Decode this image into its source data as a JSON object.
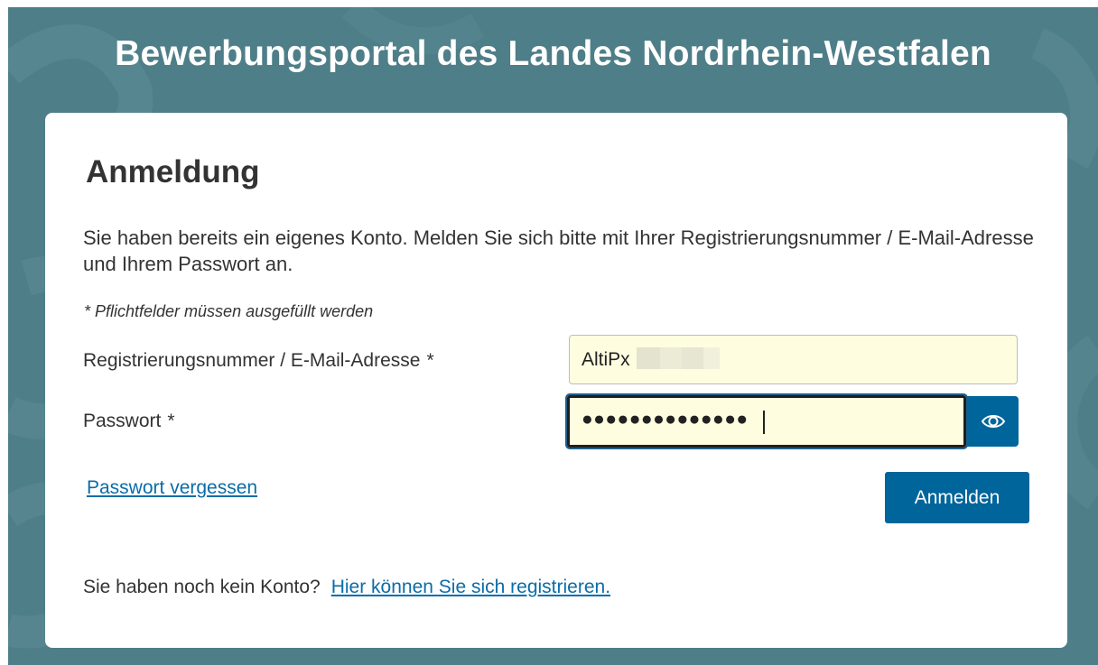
{
  "header": {
    "title": "Bewerbungsportal des Landes Nordrhein-Westfalen"
  },
  "login": {
    "title": "Anmeldung",
    "intro": "Sie haben bereits ein eigenes Konto. Melden Sie sich bitte mit Ihrer Registrierungsnummer / E-Mail-Adresse und Ihrem Passwort an.",
    "required_note": "* Pflichtfelder müssen ausgefüllt werden",
    "username_label": "Registrierungsnummer / E-Mail-Adresse",
    "username_value": "AltiPx",
    "password_label": "Passwort",
    "password_mask": "●●●●●●●●●●●●●●",
    "required_marker": "*",
    "forgot_password": "Passwort vergessen",
    "submit_label": "Anmelden",
    "no_account_text": "Sie haben noch kein Konto?",
    "register_link": "Hier können Sie sich registrieren."
  },
  "icons": {
    "password_toggle": "eye-icon"
  },
  "colors": {
    "background": "#4e7e88",
    "primary": "#00659b",
    "link": "#0a6ca8",
    "input_fill": "#fefddf"
  }
}
